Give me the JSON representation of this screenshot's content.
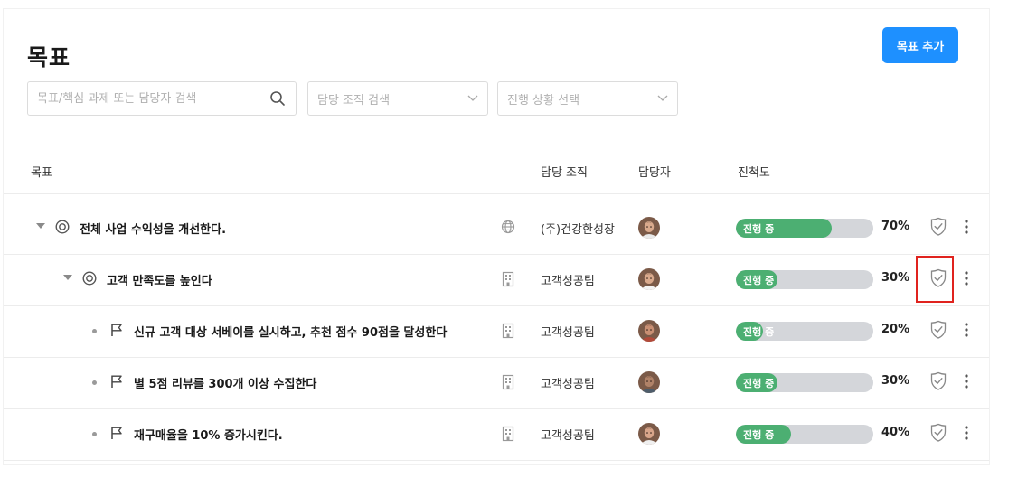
{
  "page": {
    "title": "목표",
    "add_button": "목표 추가"
  },
  "filters": {
    "search_placeholder": "목표/핵심 과제 또는 담당자 검색",
    "org_placeholder": "담당 조직 검색",
    "status_placeholder": "진행 상황 선택"
  },
  "columns": {
    "goal": "목표",
    "org": "담당 조직",
    "owner": "담당자",
    "progress": "진척도"
  },
  "colors": {
    "accent": "#1e90ff",
    "on_track": "#4caf72",
    "highlight": "#e0231e"
  },
  "rows": [
    {
      "name": "전체 사업 수익성을 개선한다.",
      "level": 0,
      "type_icon": "target-icon",
      "scope_icon": "globe-icon",
      "org": "(주)건강한성장",
      "status": "진행 중",
      "progress": 0.7,
      "percent": "70%"
    },
    {
      "name": "고객 만족도를 높인다",
      "level": 1,
      "type_icon": "target-icon",
      "scope_icon": "building-icon",
      "org": "고객성공팀",
      "status": "진행 중",
      "progress": 0.3,
      "percent": "30%"
    },
    {
      "name": "신규 고객 대상 서베이를 실시하고, 추천 점수 90점을 달성한다",
      "level": 2,
      "type_icon": "flag-icon",
      "scope_icon": "building-icon",
      "org": "고객성공팀",
      "status": "진행 중",
      "progress": 0.2,
      "percent": "20%"
    },
    {
      "name": "별 5점 리뷰를 300개 이상 수집한다",
      "level": 2,
      "type_icon": "flag-icon",
      "scope_icon": "building-icon",
      "org": "고객성공팀",
      "status": "진행 중",
      "progress": 0.3,
      "percent": "30%"
    },
    {
      "name": "재구매율을 10% 증가시킨다.",
      "level": 2,
      "type_icon": "flag-icon",
      "scope_icon": "building-icon",
      "org": "고객성공팀",
      "status": "진행 중",
      "progress": 0.4,
      "percent": "40%"
    }
  ]
}
